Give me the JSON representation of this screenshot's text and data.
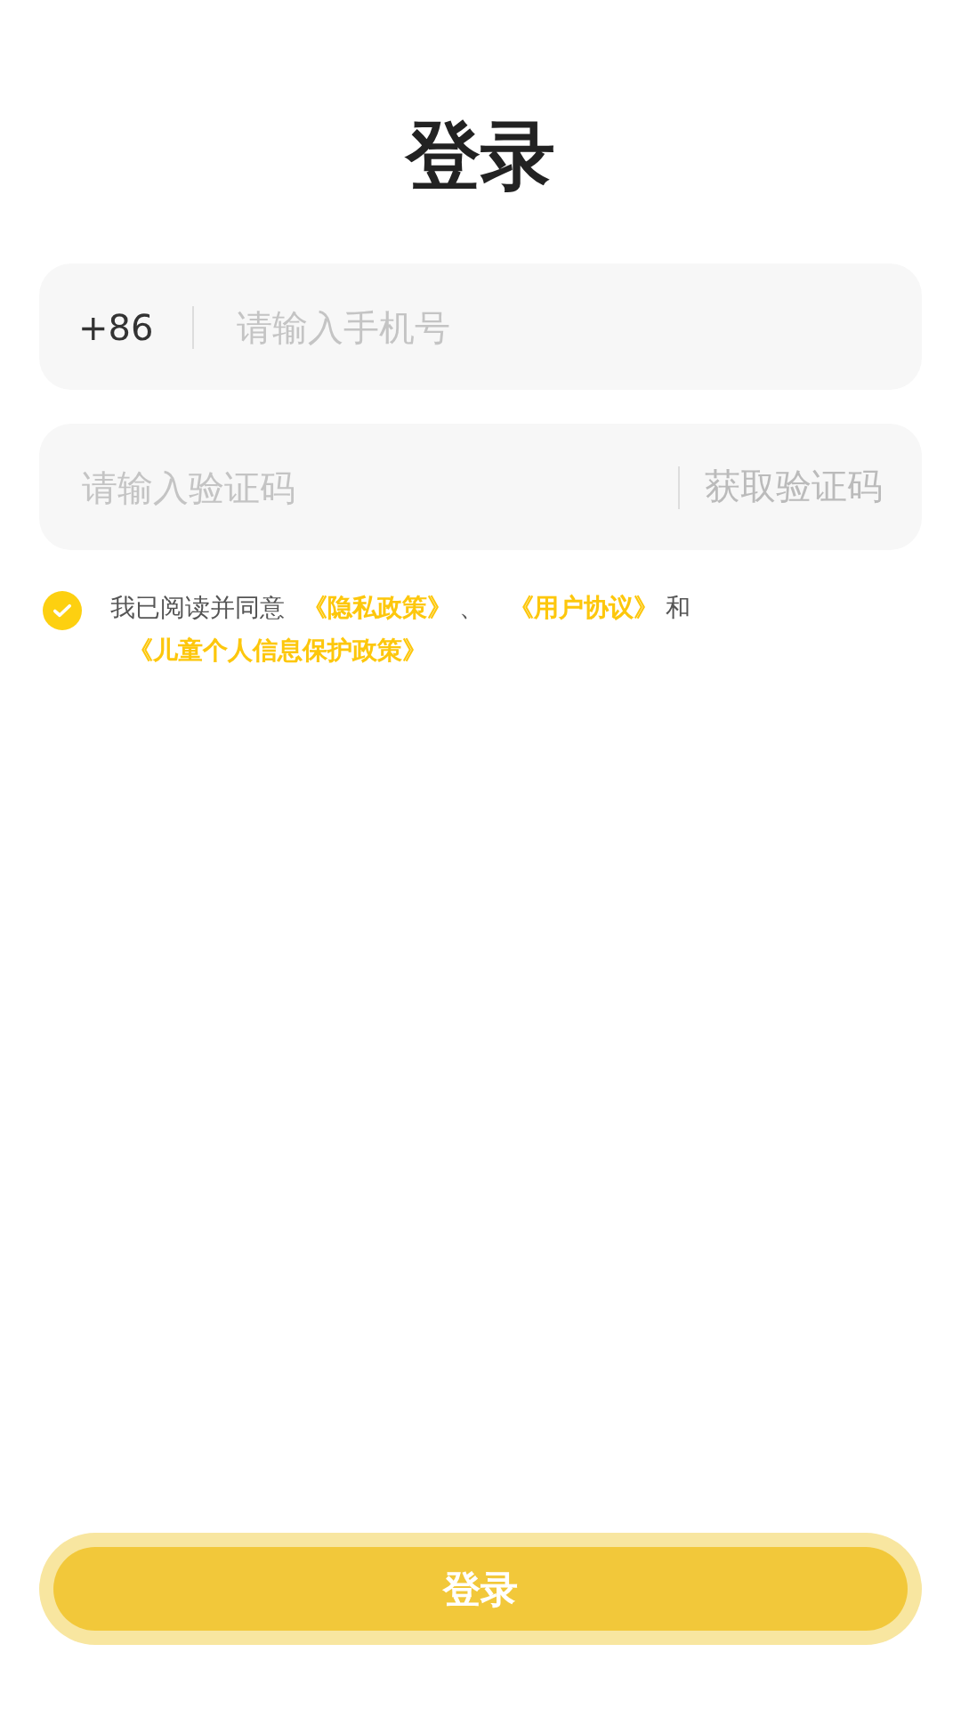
{
  "title": "登录",
  "phone": {
    "country_code": "+86",
    "placeholder": "请输入手机号"
  },
  "code": {
    "placeholder": "请输入验证码",
    "send_button": "获取验证码"
  },
  "agreement": {
    "checked": true,
    "prefix": "我已阅读并同意",
    "links": [
      {
        "text": "《隐私政策》",
        "after": "、"
      },
      {
        "text": "《用户协议》",
        "after": "和"
      },
      {
        "text": "《儿童个人信息保护政策》"
      }
    ]
  },
  "login_button": {
    "label": "登录",
    "disabled": true
  }
}
